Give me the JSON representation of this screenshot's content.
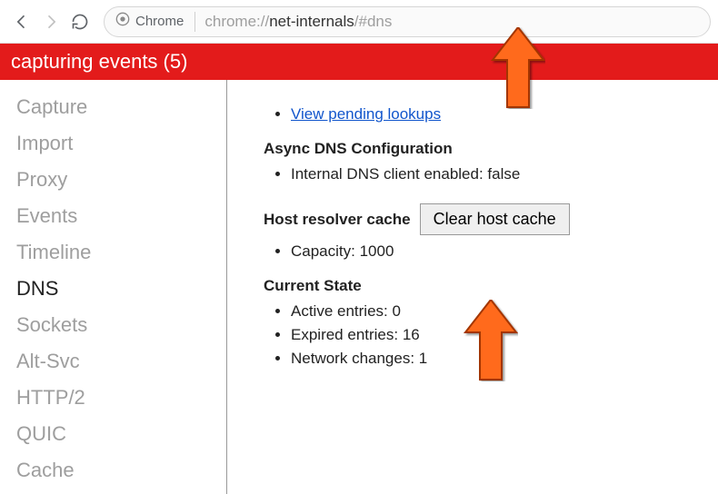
{
  "toolbar": {
    "chip_label": "Chrome",
    "url_plain_pre": "chrome://",
    "url_dark": "net-internals",
    "url_plain_post": "/#dns"
  },
  "banner": {
    "text": "capturing events (5)"
  },
  "sidebar": {
    "items": [
      {
        "label": "Capture",
        "active": false
      },
      {
        "label": "Import",
        "active": false
      },
      {
        "label": "Proxy",
        "active": false
      },
      {
        "label": "Events",
        "active": false
      },
      {
        "label": "Timeline",
        "active": false
      },
      {
        "label": "DNS",
        "active": true
      },
      {
        "label": "Sockets",
        "active": false
      },
      {
        "label": "Alt-Svc",
        "active": false
      },
      {
        "label": "HTTP/2",
        "active": false
      },
      {
        "label": "QUIC",
        "active": false
      },
      {
        "label": "Cache",
        "active": false
      }
    ]
  },
  "content": {
    "pending_link": "View pending lookups",
    "async_heading": "Async DNS Configuration",
    "async_item": "Internal DNS client enabled: false",
    "resolver_heading": "Host resolver cache",
    "clear_button": "Clear host cache",
    "capacity": "Capacity: 1000",
    "state_heading": "Current State",
    "state_items": [
      "Active entries: 0",
      "Expired entries: 16",
      "Network changes: 1"
    ]
  }
}
